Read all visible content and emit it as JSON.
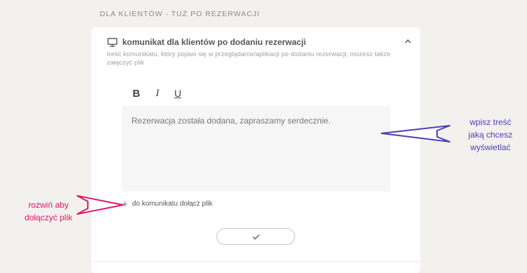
{
  "section": {
    "title": "DLA KLIENTÓW - TUŻ PO REZERWACJI"
  },
  "card": {
    "title": "komunikat dla klientów po dodaniu rezerwacji",
    "description": "treść komunikatu, który pojawi się w przeglądarce/aplikacji po dodaniu rezerwacji; możesz także załączyć plik",
    "icon": "monitor-icon",
    "collapse_icon": "chevron-up-icon"
  },
  "toolbar": {
    "bold": "B",
    "italic": "I",
    "underline": "U"
  },
  "editor": {
    "text": "Rezerwacja została dodana, zapraszamy serdecznie."
  },
  "attachment": {
    "plus": "+",
    "label": "do komunikatu dołącz plik"
  },
  "confirm": {
    "icon": "check-icon"
  },
  "annotations": {
    "purple_lines": [
      "wpisz treść",
      "jaką chcesz",
      "wyświetlać"
    ],
    "pink_lines": [
      "rozwiń aby",
      "dołączyć plik"
    ]
  },
  "colors": {
    "background": "#f2f1ee",
    "card": "#ffffff",
    "annotation_purple": "#4e3fb2",
    "annotation_pink": "#e0186c"
  }
}
